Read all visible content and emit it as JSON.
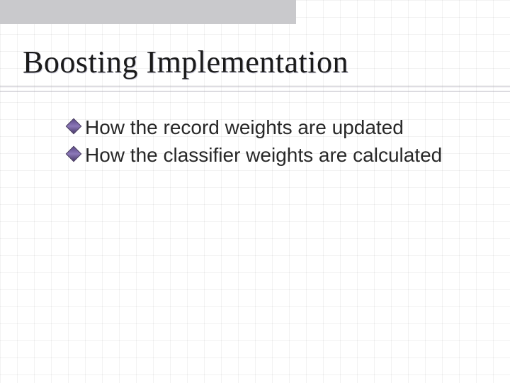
{
  "slide": {
    "title": "Boosting Implementation",
    "bullets": [
      "How the record weights are updated",
      "How the classifier weights are calculated"
    ]
  }
}
